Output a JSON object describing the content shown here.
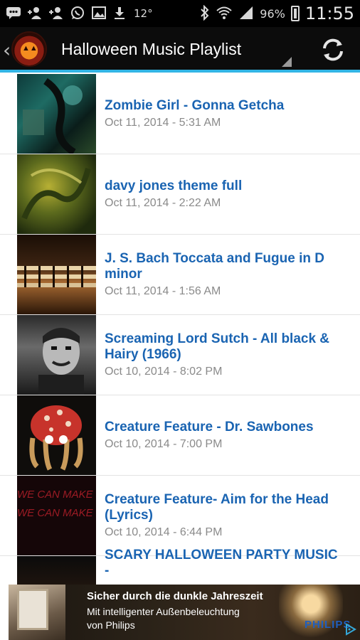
{
  "status_bar": {
    "temperature": "12°",
    "battery_percent": "96%",
    "time": "11:55",
    "left_icons": [
      "chat-icon",
      "add-user-icon",
      "add-user-icon",
      "whatsapp-icon",
      "image-icon",
      "download-icon"
    ],
    "right_icons": [
      "bluetooth-icon",
      "wifi-icon",
      "signal-icon",
      "battery-icon"
    ]
  },
  "action_bar": {
    "title": "Halloween Music Playlist",
    "refresh_icon": "refresh-icon",
    "accent_color": "#33b5e5"
  },
  "playlist": [
    {
      "title": "Zombie Girl - Gonna Getcha",
      "date": "Oct 11, 2014 - 5:31 AM"
    },
    {
      "title": "davy jones theme full",
      "date": "Oct 11, 2014 - 2:22 AM"
    },
    {
      "title": "J. S. Bach Toccata and Fugue in D minor",
      "date": "Oct 11, 2014 - 1:56 AM"
    },
    {
      "title": "Screaming Lord Sutch - All black & Hairy (1966)",
      "date": "Oct 10, 2014 - 8:02 PM"
    },
    {
      "title": "Creature Feature - Dr. Sawbones",
      "date": "Oct 10, 2014 - 7:00 PM"
    },
    {
      "title": "Creature Feature- Aim for the Head (Lyrics)",
      "date": "Oct 10, 2014 - 6:44 PM"
    },
    {
      "title": "SCARY HALLOWEEN PARTY MUSIC -",
      "date": ""
    }
  ],
  "thumbnail_text": {
    "row6": [
      "WE CAN MAKE IT",
      "WE CAN MAKE IT"
    ]
  },
  "ad": {
    "headline": "Sicher durch die dunkle Jahreszeit",
    "line1": "Mit intelligenter Außenbeleuchtung",
    "line2": "von Philips",
    "brand": "PHILIPS",
    "info_icon": "ad-choices-icon"
  },
  "colors": {
    "title_text": "#1a64b2",
    "date_text": "#8a8a8a",
    "brand_blue": "#1f5fbf"
  }
}
